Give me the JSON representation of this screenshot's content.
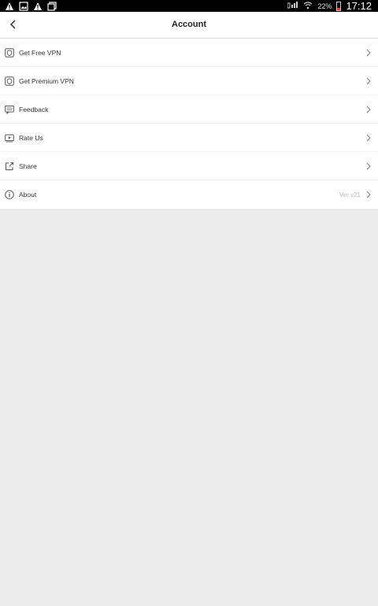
{
  "status_bar": {
    "battery_percent": "22%",
    "time": "17:12"
  },
  "header": {
    "title": "Account"
  },
  "menu": {
    "items": [
      {
        "label": "Get Free VPN",
        "icon": "shield-icon"
      },
      {
        "label": "Get Premium VPN",
        "icon": "shield-icon"
      },
      {
        "label": "Feedback",
        "icon": "message-icon"
      },
      {
        "label": "Rate Us",
        "icon": "play-icon"
      },
      {
        "label": "Share",
        "icon": "share-icon"
      },
      {
        "label": "About",
        "icon": "info-icon",
        "value": "Ver v21"
      }
    ]
  },
  "colors": {
    "background": "#ececec",
    "surface": "#ffffff",
    "text": "#333333",
    "muted": "#bdbdbd",
    "battery_low": "#e53935"
  }
}
